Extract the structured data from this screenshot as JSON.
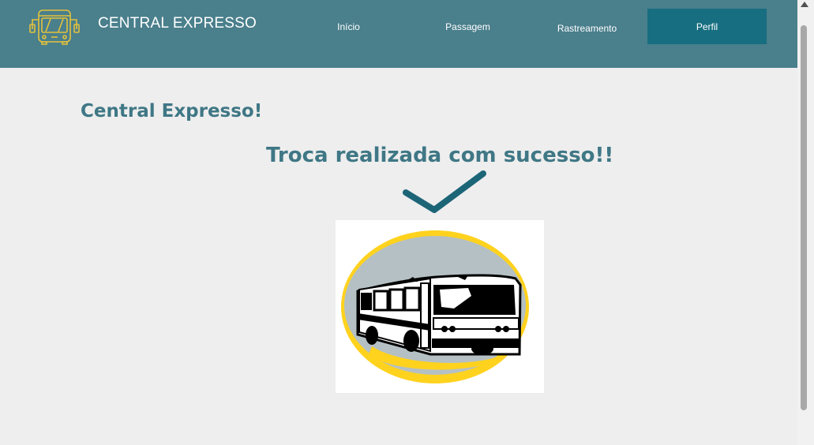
{
  "header": {
    "brand": "CENTRAL EXPRESSO",
    "logo_icon": "bus-icon",
    "nav": {
      "inicio": "Início",
      "passagem": "Passagem",
      "rastreamento": "Rastreamento",
      "perfil": "Perfil"
    }
  },
  "main": {
    "title": "Central Expresso!",
    "message": "Troca realizada com sucesso!!",
    "check_icon": "checkmark-icon",
    "illustration": "bus-illustration"
  },
  "colors": {
    "navbar": "#4a7f8c",
    "nav_active": "#176e80",
    "text_accent": "#3f7785",
    "logo": "#e3c23c",
    "background": "#eeeeee"
  }
}
